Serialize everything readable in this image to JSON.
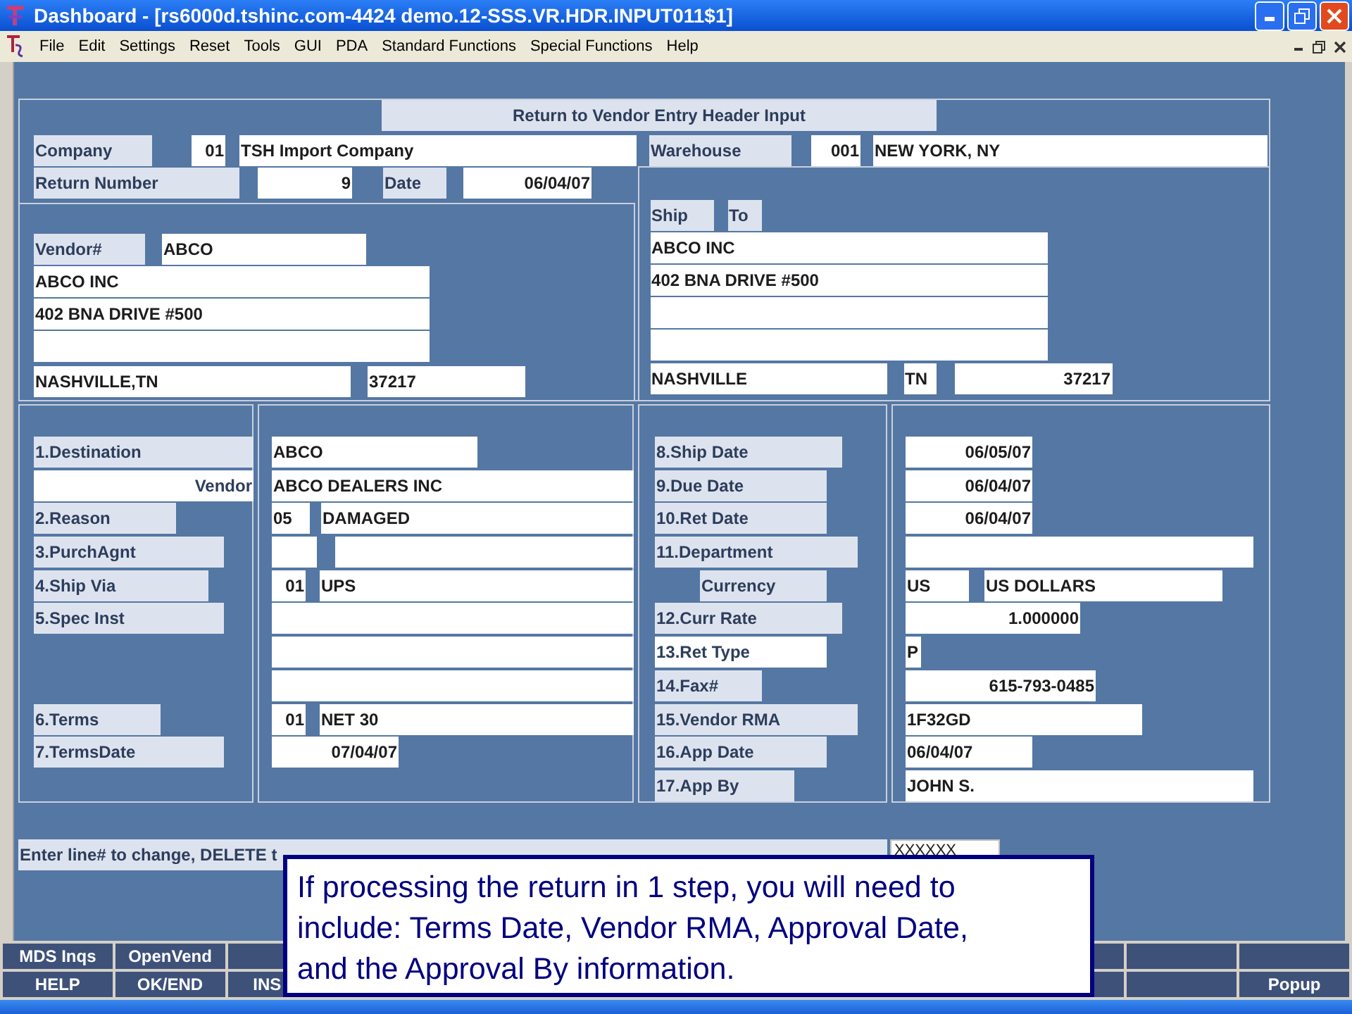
{
  "window": {
    "title": "Dashboard - [rs6000d.tshinc.com-4424 demo.12-SSS.VR.HDR.INPUT011$1]"
  },
  "menu": [
    "File",
    "Edit",
    "Settings",
    "Reset",
    "Tools",
    "GUI",
    "PDA",
    "Standard Functions",
    "Special Functions",
    "Help"
  ],
  "form": {
    "title": "Return to Vendor Entry Header Input",
    "company": {
      "label": "Company",
      "code": "01",
      "name": "TSH Import Company"
    },
    "warehouse": {
      "label": "Warehouse",
      "code": "001",
      "name": "NEW YORK, NY"
    },
    "return_number": {
      "label": "Return Number",
      "value": "9"
    },
    "date": {
      "label": "Date",
      "value": "06/04/07"
    },
    "vendor": {
      "label": "Vendor#",
      "value": "ABCO",
      "lines": [
        "ABCO INC",
        "402 BNA DRIVE #500"
      ],
      "city": "NASHVILLE,TN",
      "zip": "37217"
    },
    "ship_to": {
      "label_1": "Ship",
      "label_2": "To",
      "lines": [
        "ABCO INC",
        "402 BNA DRIVE #500"
      ],
      "city": "NASHVILLE",
      "state": "TN",
      "zip": "37217"
    },
    "left_fields": [
      {
        "label": "1.Destination",
        "kind": "numbered",
        "values": [
          "ABCO"
        ]
      },
      {
        "label": "Vendor",
        "kind": "sublabel",
        "values": [
          "ABCO DEALERS INC"
        ]
      },
      {
        "label": "2.Reason",
        "kind": "numbered",
        "values": [
          "05",
          "DAMAGED"
        ]
      },
      {
        "label": "3.PurchAgnt",
        "kind": "numbered"
      },
      {
        "label": "4.Ship Via",
        "kind": "numbered",
        "values": [
          "01",
          "UPS"
        ]
      },
      {
        "label": "5.Spec Inst",
        "kind": "numbered"
      },
      {
        "label": "6.Terms",
        "kind": "numbered",
        "values": [
          "01",
          "NET 30"
        ]
      },
      {
        "label": "7.TermsDate",
        "kind": "numbered",
        "values": [
          "07/04/07"
        ]
      }
    ],
    "right_fields": [
      {
        "label": "8.Ship Date",
        "kind": "numbered",
        "selected": false,
        "values": [
          "06/05/07"
        ]
      },
      {
        "label": "9.Due Date",
        "kind": "numbered",
        "selected": false,
        "values": [
          "06/04/07"
        ]
      },
      {
        "label": "10.Ret Date",
        "kind": "numbered",
        "selected": false,
        "values": [
          "06/04/07"
        ]
      },
      {
        "label": "11.Department",
        "kind": "numbered",
        "selected": false
      },
      {
        "label": "Currency",
        "kind": "sublabel",
        "selected": false,
        "values": [
          "US",
          "US DOLLARS"
        ]
      },
      {
        "label": "12.Curr Rate",
        "kind": "numbered",
        "selected": false,
        "values": [
          "1.000000"
        ]
      },
      {
        "label": "13.Ret Type",
        "kind": "numbered",
        "selected": true,
        "values": [
          "P"
        ]
      },
      {
        "label": "14.Fax#",
        "kind": "numbered",
        "selected": false,
        "values": [
          "615-793-0485"
        ]
      },
      {
        "label": "15.Vendor RMA",
        "kind": "numbered",
        "selected": false,
        "values": [
          "1F32GD"
        ]
      },
      {
        "label": "16.App Date",
        "kind": "numbered",
        "selected": false,
        "values": [
          "06/04/07"
        ]
      },
      {
        "label": "17.App By",
        "kind": "numbered",
        "selected": false,
        "values": [
          "JOHN S."
        ]
      }
    ]
  },
  "prompt": {
    "text": "Enter line# to change, DELETE t",
    "value": "XXXXXX"
  },
  "function_keys": {
    "row_1": [
      "MDS Inqs",
      "OpenVend"
    ],
    "row_2": [
      "HELP",
      "OK/END",
      "INS"
    ],
    "last": "Popup"
  },
  "callout": {
    "text": "If processing the return in 1 step, you will need to include: Terms Date, Vendor RMA, Approval Date, and the Approval By information."
  }
}
